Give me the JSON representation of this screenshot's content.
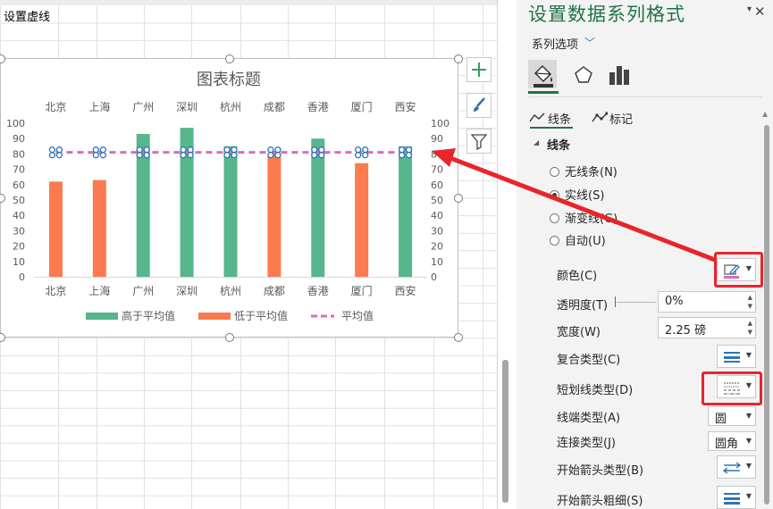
{
  "sheet": {
    "cell_a1": "设置虚线"
  },
  "chart_data": {
    "type": "bar",
    "title": "图表标题",
    "categories": [
      "北京",
      "上海",
      "广州",
      "深圳",
      "杭州",
      "成都",
      "香港",
      "厦门",
      "西安"
    ],
    "top_categories": [
      "北京",
      "上海",
      "广州",
      "深圳",
      "杭州",
      "成都",
      "香港",
      "厦门",
      "西安"
    ],
    "series": [
      {
        "name": "高于平均值",
        "color": "#56b68c",
        "values": [
          null,
          null,
          93,
          97,
          85,
          null,
          90,
          null,
          85
        ]
      },
      {
        "name": "低于平均值",
        "color": "#fb7a4f",
        "values": [
          62,
          63,
          null,
          null,
          null,
          80,
          null,
          74,
          null
        ]
      },
      {
        "name": "平均值",
        "type": "line",
        "style": "dashed",
        "color": "#d96bbf",
        "values": [
          81,
          81,
          81,
          81,
          81,
          81,
          81,
          81,
          81
        ]
      }
    ],
    "ylim": [
      0,
      100
    ],
    "yticks": [
      0,
      10,
      20,
      30,
      40,
      50,
      60,
      70,
      80,
      90,
      100
    ],
    "y2ticks": [
      0,
      10,
      20,
      30,
      40,
      50,
      60,
      70,
      80,
      90,
      100
    ],
    "legend": "bottom",
    "grid": false
  },
  "pane": {
    "title": "设置数据系列格式",
    "series_options": "系列选项",
    "tabs": [
      "线条",
      "标记"
    ],
    "section": "线条",
    "line_options": [
      {
        "label": "无线条(N)",
        "selected": false
      },
      {
        "label": "实线(S)",
        "selected": true
      },
      {
        "label": "渐变线(G)",
        "selected": false
      },
      {
        "label": "自动(U)",
        "selected": false
      }
    ],
    "props": {
      "color": "颜色(C)",
      "transparency": "透明度(T)",
      "transparency_value": "0%",
      "width": "宽度(W)",
      "width_value": "2.25 磅",
      "compound": "复合类型(C)",
      "dash": "短划线类型(D)",
      "cap": "线端类型(A)",
      "cap_value": "圆",
      "join": "连接类型(J)",
      "join_value": "圆角",
      "begin_arrow": "开始箭头类型(B)",
      "begin_arrow_size": "开始箭头粗细(S)"
    }
  },
  "colors": {
    "accent_green": "#217346",
    "callout_red": "#e8242d",
    "average_line": "#d96bbf"
  }
}
